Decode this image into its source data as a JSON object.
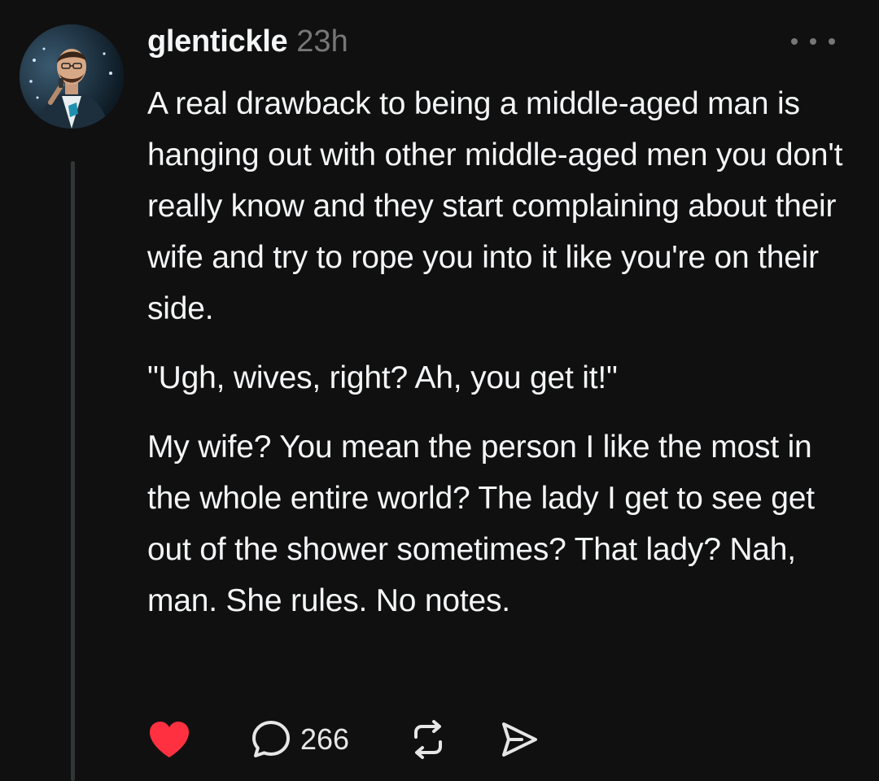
{
  "post": {
    "author": {
      "username": "glentickle",
      "avatar": "avatar-photo-icon"
    },
    "timestamp": "23h",
    "more_icon": "more-dots-icon",
    "paragraphs": [
      "A real drawback to being a middle-aged man is hanging out with other middle-aged men you don't really know and they start complaining about their wife and try to rope you into it like you're on their side.",
      "\"Ugh, wives, right? Ah, you get it!\"",
      "My wife? You mean the person I like the most in the whole entire world? The lady I get to see get out of the shower sometimes? That lady? Nah, man. She rules. No notes."
    ],
    "actions": {
      "like": {
        "icon": "heart-icon",
        "liked": true,
        "color": "#ff3040"
      },
      "reply": {
        "icon": "comment-bubble-icon",
        "count": "266"
      },
      "repost": {
        "icon": "repost-icon"
      },
      "share": {
        "icon": "send-icon"
      }
    }
  },
  "colors": {
    "background": "#101010",
    "text": "#f3f5f7",
    "secondary": "#777777",
    "thread_line": "#333638",
    "like": "#ff3040"
  }
}
